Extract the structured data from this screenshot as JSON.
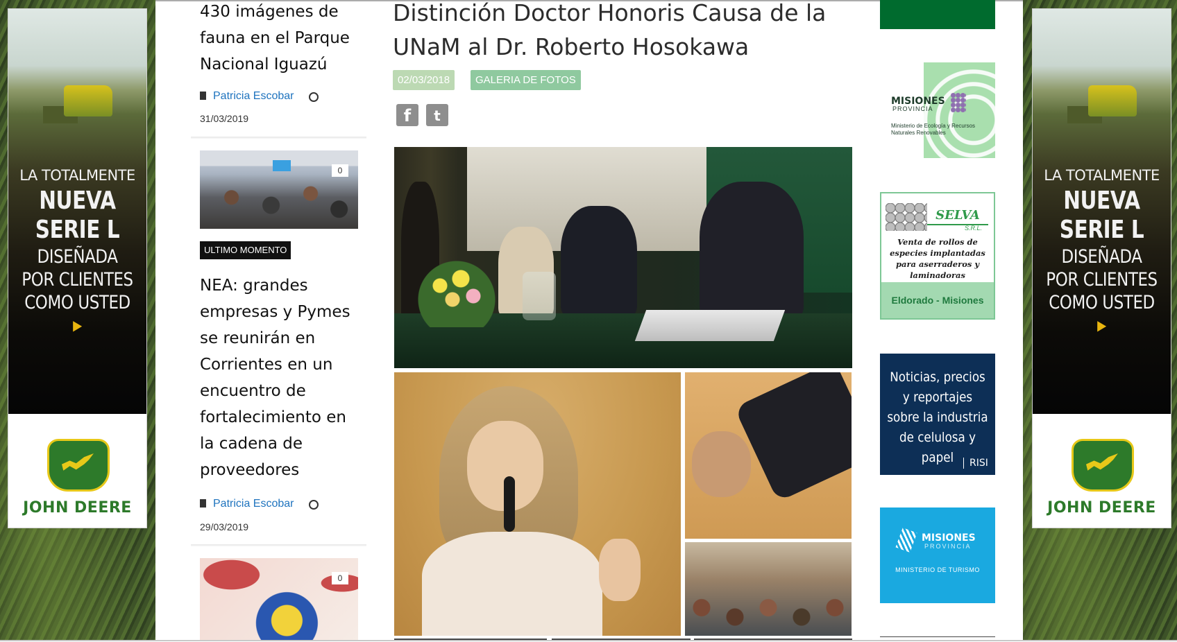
{
  "side_ads": {
    "line1": "LA TOTALMENTE",
    "line2": "NUEVA",
    "line3": "SERIE L",
    "line4": "DISEÑADA",
    "line5": "POR CLIENTES",
    "line6": "COMO USTED",
    "brand": "JOHN DEERE"
  },
  "left_column": {
    "articles": [
      {
        "title": "430 imágenes de fauna en el Parque Nacional Iguazú",
        "author": "Patricia Escobar",
        "date": "31/03/2019"
      },
      {
        "comments": "0",
        "category": "ULTIMO MOMENTO",
        "title": "NEA: grandes empresas y Pymes se reunirán en Corrientes en un encuentro de fortalecimiento en la cadena de proveedores",
        "author": "Patricia Escobar",
        "date": "29/03/2019"
      },
      {
        "comments": "0"
      }
    ]
  },
  "article": {
    "title": "Distinción Doctor Honoris Causa de la UNaM al Dr. Roberto Hosokawa",
    "date": "02/03/2018",
    "category": "GALERIA DE FOTOS",
    "share_icons": [
      "facebook-icon",
      "twitter-icon"
    ]
  },
  "right_ads": {
    "ecologia": {
      "name": "MISIONES",
      "sub": "PROVINCIA",
      "ministry": "Ministerio de Ecología y Recursos Naturales Renovables"
    },
    "selva": {
      "name": "SELVA",
      "srl": "S.R.L.",
      "description": "Venta de rollos de especies implantadas para aserraderos y laminadoras",
      "location": "Eldorado - Misiones"
    },
    "risi": {
      "text": "Noticias, precios y reportajes sobre la industria de celulosa y papel",
      "logo": "RISI"
    },
    "turismo": {
      "name": "MISIONES",
      "sub": "PROVINCIA",
      "ministry": "MINISTERIO DE TURISMO"
    }
  },
  "colors": {
    "link": "#1e73be",
    "date_pill": "#bcd9b3",
    "category_pill": "#8fc99f",
    "dark_green": "#006b2e"
  }
}
